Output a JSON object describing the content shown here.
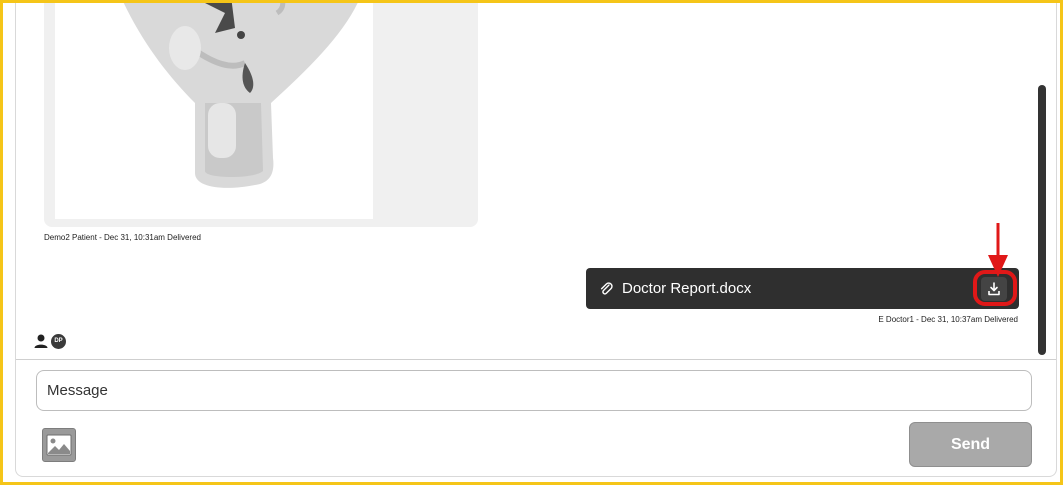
{
  "messages": {
    "incoming_meta": "Demo2 Patient - Dec 31, 10:31am Delivered",
    "file_name": "Doctor Report.docx",
    "outgoing_meta": "E Doctor1 - Dec 31, 10:37am Delivered"
  },
  "participants": {
    "badge_initials": "DP"
  },
  "composer": {
    "placeholder": "Message",
    "send_label": "Send"
  },
  "icons": {
    "attachment": "paperclip-icon",
    "download": "download-icon",
    "image": "image-icon",
    "person": "person-icon"
  },
  "colors": {
    "highlight": "#e01818",
    "border": "#f5c518",
    "file_bubble": "#2f2f2f"
  }
}
